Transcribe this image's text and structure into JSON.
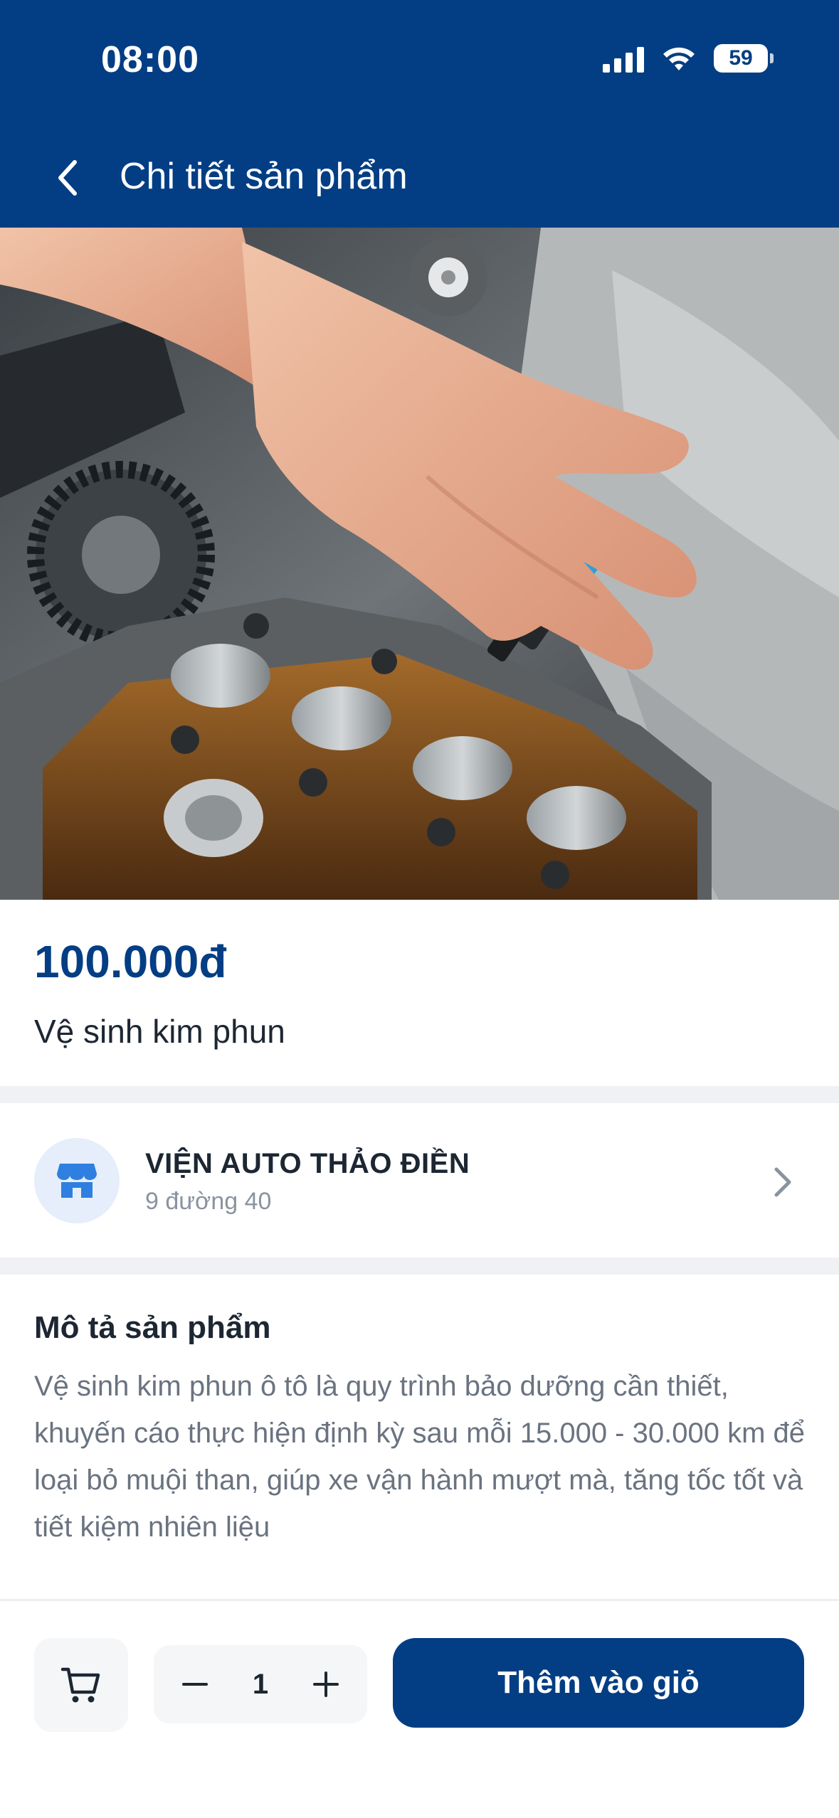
{
  "status_bar": {
    "time": "08:00",
    "battery": "59"
  },
  "header": {
    "title": "Chi tiết sản phẩm"
  },
  "product": {
    "price": "100.000đ",
    "name": "Vệ sinh kim phun",
    "image_icon": "fuel-injector-engine-photo"
  },
  "store": {
    "name": "VIỆN AUTO THẢO ĐIỀN",
    "address": "9 đường 40",
    "icon": "store-icon"
  },
  "description": {
    "title": "Mô tả sản phẩm",
    "text": "Vệ sinh kim phun ô tô là quy trình bảo dưỡng cần thiết, khuyến cáo thực hiện định kỳ sau mỗi 15.000 - 30.000 km để loại bỏ muội than, giúp xe vận hành mượt mà, tăng tốc tốt và tiết kiệm nhiên liệu"
  },
  "bottom_bar": {
    "quantity": "1",
    "add_to_cart_label": "Thêm vào giỏ"
  },
  "colors": {
    "primary": "#033e84",
    "background": "#ffffff",
    "divider": "#eff1f4",
    "muted_text": "#6a7380"
  }
}
